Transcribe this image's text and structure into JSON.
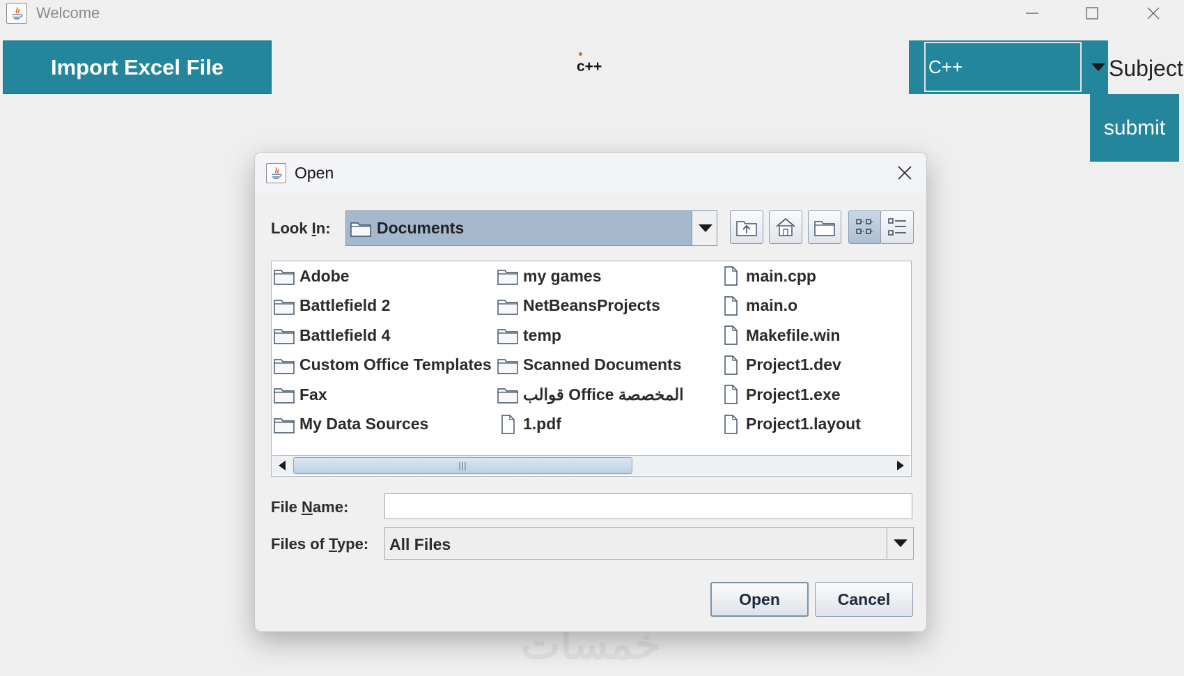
{
  "window": {
    "title": "Welcome",
    "icons": {
      "app": "java-app-icon",
      "minimize": "minimize-icon",
      "maximize": "maximize-icon",
      "close": "close-icon"
    }
  },
  "main": {
    "import_button": "Import Excel File",
    "center_label": "c++",
    "subject_combo": {
      "value": "C++",
      "label": "Subject"
    },
    "submit_button": "submit"
  },
  "dialog": {
    "title": "Open",
    "look_in": {
      "label_prefix": "Look ",
      "label_mnemonic": "I",
      "label_suffix": "n:",
      "value": "Documents"
    },
    "toolbar": [
      "up-one-level-icon",
      "home-icon",
      "new-folder-icon",
      "list-view-icon",
      "details-view-icon"
    ],
    "files": [
      {
        "name": "Adobe",
        "type": "folder"
      },
      {
        "name": "Battlefield 2",
        "type": "folder"
      },
      {
        "name": "Battlefield 4",
        "type": "folder"
      },
      {
        "name": "Custom Office Templates",
        "type": "folder"
      },
      {
        "name": "Fax",
        "type": "folder"
      },
      {
        "name": "My Data Sources",
        "type": "folder"
      },
      {
        "name": "my games",
        "type": "folder"
      },
      {
        "name": "NetBeansProjects",
        "type": "folder"
      },
      {
        "name": "temp",
        "type": "folder"
      },
      {
        "name": "Scanned Documents",
        "type": "folder"
      },
      {
        "name": "قوالب Office المخصصة",
        "type": "folder"
      },
      {
        "name": "1.pdf",
        "type": "file"
      },
      {
        "name": "main.cpp",
        "type": "file"
      },
      {
        "name": "main.o",
        "type": "file"
      },
      {
        "name": "Makefile.win",
        "type": "file"
      },
      {
        "name": "Project1.dev",
        "type": "file"
      },
      {
        "name": "Project1.exe",
        "type": "file"
      },
      {
        "name": "Project1.layout",
        "type": "file"
      }
    ],
    "file_name": {
      "label_prefix": "File ",
      "label_mnemonic": "N",
      "label_suffix": "ame:",
      "value": ""
    },
    "files_of_type": {
      "label_prefix": "Files of ",
      "label_mnemonic": "T",
      "label_suffix": "ype:",
      "value": "All Files"
    },
    "open_button": "Open",
    "cancel_button": "Cancel"
  },
  "watermark": "خمسات",
  "colors": {
    "accent": "#23869c",
    "dialog_bg": "#f0f0f0",
    "combo_selected": "#a4b8ce"
  }
}
